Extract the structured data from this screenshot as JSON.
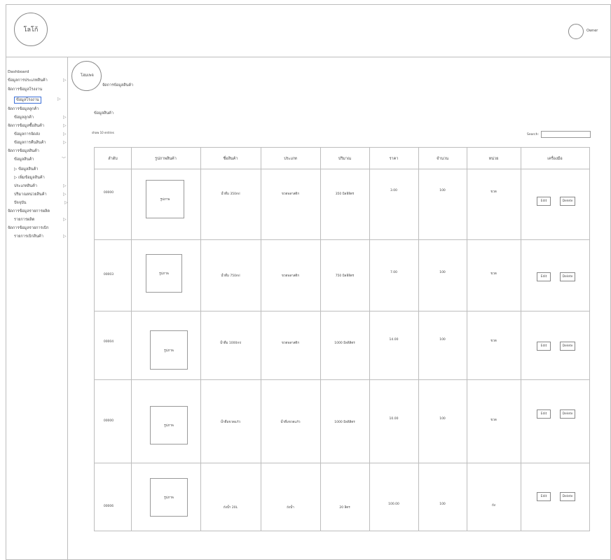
{
  "header": {
    "logo_text": "โลโก้",
    "owner_label": "Owner"
  },
  "sidebar": {
    "items": [
      {
        "label": "Dashboard",
        "arrow": ""
      },
      {
        "label": "ข้อมูลการประเภทสินค้า",
        "arrow": "▷"
      },
      {
        "label": "จัดการข้อมูลโรงงาน",
        "arrow": ""
      },
      {
        "label": "ข้อมูลโรงงาน",
        "arrow": "▷"
      },
      {
        "label": "จัดการข้อมูลลูกค้า",
        "arrow": ""
      },
      {
        "label": "ข้อมูลลูกค้า",
        "arrow": "▷"
      },
      {
        "label": "จัดการข้อมูลซื้อสินค้า",
        "arrow": "▷"
      },
      {
        "label": "ข้อมูลการจัดส่ง",
        "arrow": "▷"
      },
      {
        "label": "ข้อมูลการคืนสินค้า",
        "arrow": "▷"
      },
      {
        "label": "จัดการข้อมูลสินค้า",
        "arrow": ""
      },
      {
        "label": "ข้อมูลสินค้า",
        "arrow": "﹀"
      },
      {
        "label": "▷ ข้อมูลสินค้า",
        "arrow": ""
      },
      {
        "label": "▷ เพิ่มข้อมูลสินค้า",
        "arrow": ""
      },
      {
        "label": "ประเภทสินค้า",
        "arrow": "▷"
      },
      {
        "label": "ปริมาณหน่วยสินค้า",
        "arrow": "▷"
      },
      {
        "label": "ปัจจุบัน",
        "arrow": "▷"
      },
      {
        "label": "จัดการข้อมูลรายการผลิต",
        "arrow": ""
      },
      {
        "label": "รายการผลิต",
        "arrow": "▷"
      },
      {
        "label": "จัดการข้อมูลรายการเบิก",
        "arrow": ""
      },
      {
        "label": "รายการเบิกสินค้า",
        "arrow": "▷"
      }
    ]
  },
  "main": {
    "home_label": "โฮมเพจ",
    "breadcrumb": "จัดการข้อมูลสินค้า",
    "section_title": "ข้อมูลสินค้า",
    "show_entries": "show 10 entries",
    "search_label": "Search:",
    "search_value": ""
  },
  "table": {
    "headers": [
      "ลำดับ",
      "รูปภาพสินค้า",
      "ชื่อสินค้า",
      "ประเภท",
      "ปริมาณ",
      "ราคา",
      "จำนวน",
      "หน่วย",
      "เครื่องมือ"
    ],
    "rows": [
      {
        "id": "00000",
        "image": "รูปภาพ",
        "name": "น้ำดื่ม 350ml",
        "type": "ขวดพลาสติก",
        "volume": "350 มิลลิลิตร",
        "price": "3.00",
        "qty": "100",
        "unit": "ขวด"
      },
      {
        "id": "00003",
        "image": "รูปภาพ",
        "name": "น้ำดื่ม 750ml",
        "type": "ขวดพลาสติก",
        "volume": "750 มิลลิลิตร",
        "price": "7.00",
        "qty": "100",
        "unit": "ขวด"
      },
      {
        "id": "00004",
        "image": "รูปภาพ",
        "name": "น้ำดื่ม 1000ml",
        "type": "ขวดพลาสติก",
        "volume": "1000 มิลลิลิตร",
        "price": "14.00",
        "qty": "100",
        "unit": "ขวด"
      },
      {
        "id": "00000",
        "image": "รูปภาพ",
        "name": "น้ำดื่มขวดแก้ว",
        "type": "น้ำดื่มขวดแก้ว",
        "volume": "1000 มิลลิลิตร",
        "price": "10.00",
        "qty": "100",
        "unit": "ขวด"
      },
      {
        "id": "00006",
        "image": "รูปภาพ",
        "name": "ถังน้ำ 20L",
        "type": "ถังน้ำ",
        "volume": "20 ลิตร",
        "price": "100.00",
        "qty": "100",
        "unit": "ถัง"
      }
    ],
    "edit_label": "Edit",
    "delete_label": "Delete"
  }
}
